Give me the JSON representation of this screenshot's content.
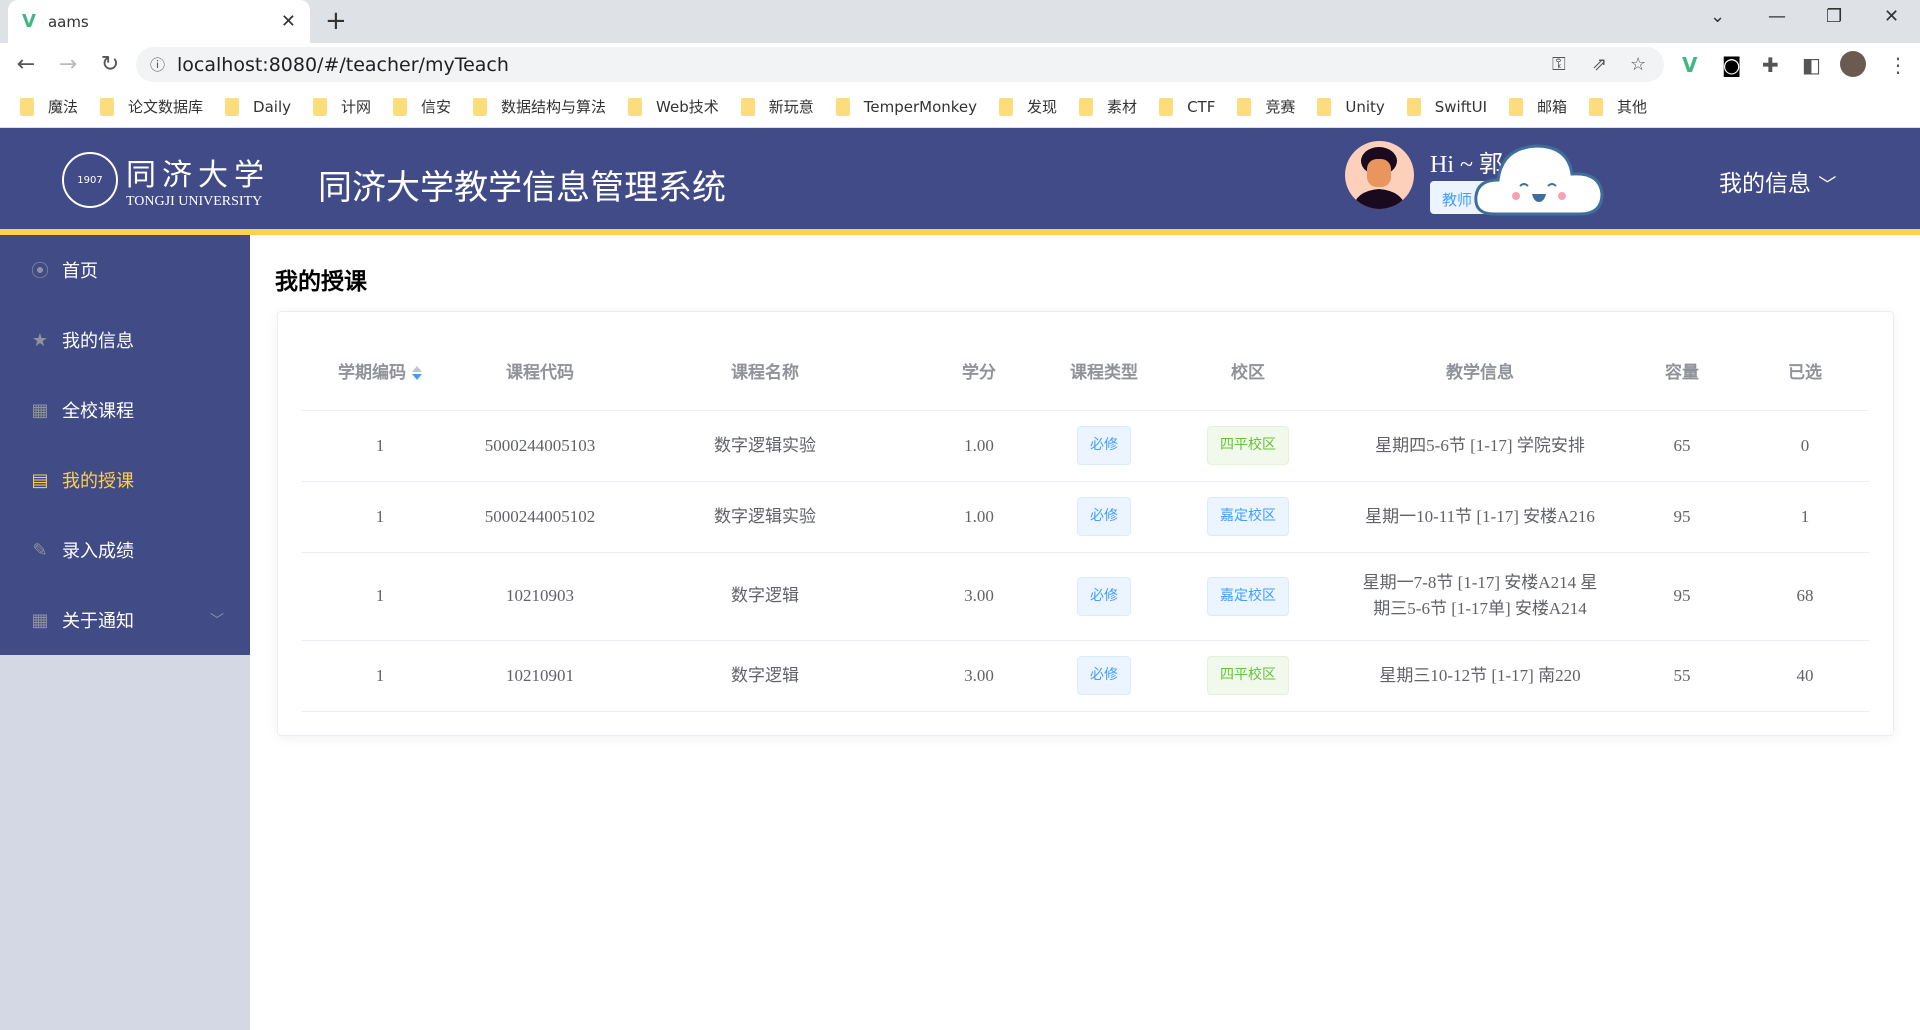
{
  "browser": {
    "tab_title": "aams",
    "url": "localhost:8080/#/teacher/myTeach",
    "bookmarks": [
      "魔法",
      "论文数据库",
      "Daily",
      "计网",
      "信安",
      "数据结构与算法",
      "Web技术",
      "新玩意",
      "TemperMonkey",
      "发现",
      "素材",
      "CTF",
      "竞赛",
      "Unity",
      "SwiftUI",
      "邮箱",
      "其他"
    ]
  },
  "header": {
    "logo_cn": "同济大学",
    "logo_en": "TONGJI UNIVERSITY",
    "title": "同济大学教学信息管理系统",
    "greeting": "Hi ~ 郭",
    "role": "教师",
    "menu_label": "我的信息"
  },
  "sidebar": {
    "items": [
      {
        "label": "首页",
        "icon": "location-icon"
      },
      {
        "label": "我的信息",
        "icon": "star-icon"
      },
      {
        "label": "全校课程",
        "icon": "grid-icon"
      },
      {
        "label": "我的授课",
        "icon": "calendar-icon",
        "active": true
      },
      {
        "label": "录入成绩",
        "icon": "edit-icon"
      },
      {
        "label": "关于通知",
        "icon": "grid-icon",
        "expandable": true
      }
    ]
  },
  "colors": {
    "header_bg": "#414b87",
    "accent": "#ffd04b",
    "tag_blue": "#409eff",
    "tag_green": "#67c23a"
  },
  "main": {
    "title": "我的授课",
    "columns": [
      "学期编码",
      "课程代码",
      "课程名称",
      "学分",
      "课程类型",
      "校区",
      "教学信息",
      "容量",
      "已选"
    ],
    "rows": [
      [
        "1",
        "5000244005103",
        "数字逻辑实验",
        "1.00",
        "必修",
        "四平校区",
        "星期四5-6节 [1-17] 学院安排",
        "65",
        "0"
      ],
      [
        "1",
        "5000244005102",
        "数字逻辑实验",
        "1.00",
        "必修",
        "嘉定校区",
        "星期一10-11节 [1-17] 安楼A216",
        "95",
        "1"
      ],
      [
        "1",
        "10210903",
        "数字逻辑",
        "3.00",
        "必修",
        "嘉定校区",
        "星期一7-8节 [1-17] 安楼A214 星期三5-6节 [1-17单] 安楼A214",
        "95",
        "68"
      ],
      [
        "1",
        "10210901",
        "数字逻辑",
        "3.00",
        "必修",
        "四平校区",
        "星期三10-12节 [1-17] 南220",
        "55",
        "40"
      ]
    ]
  }
}
